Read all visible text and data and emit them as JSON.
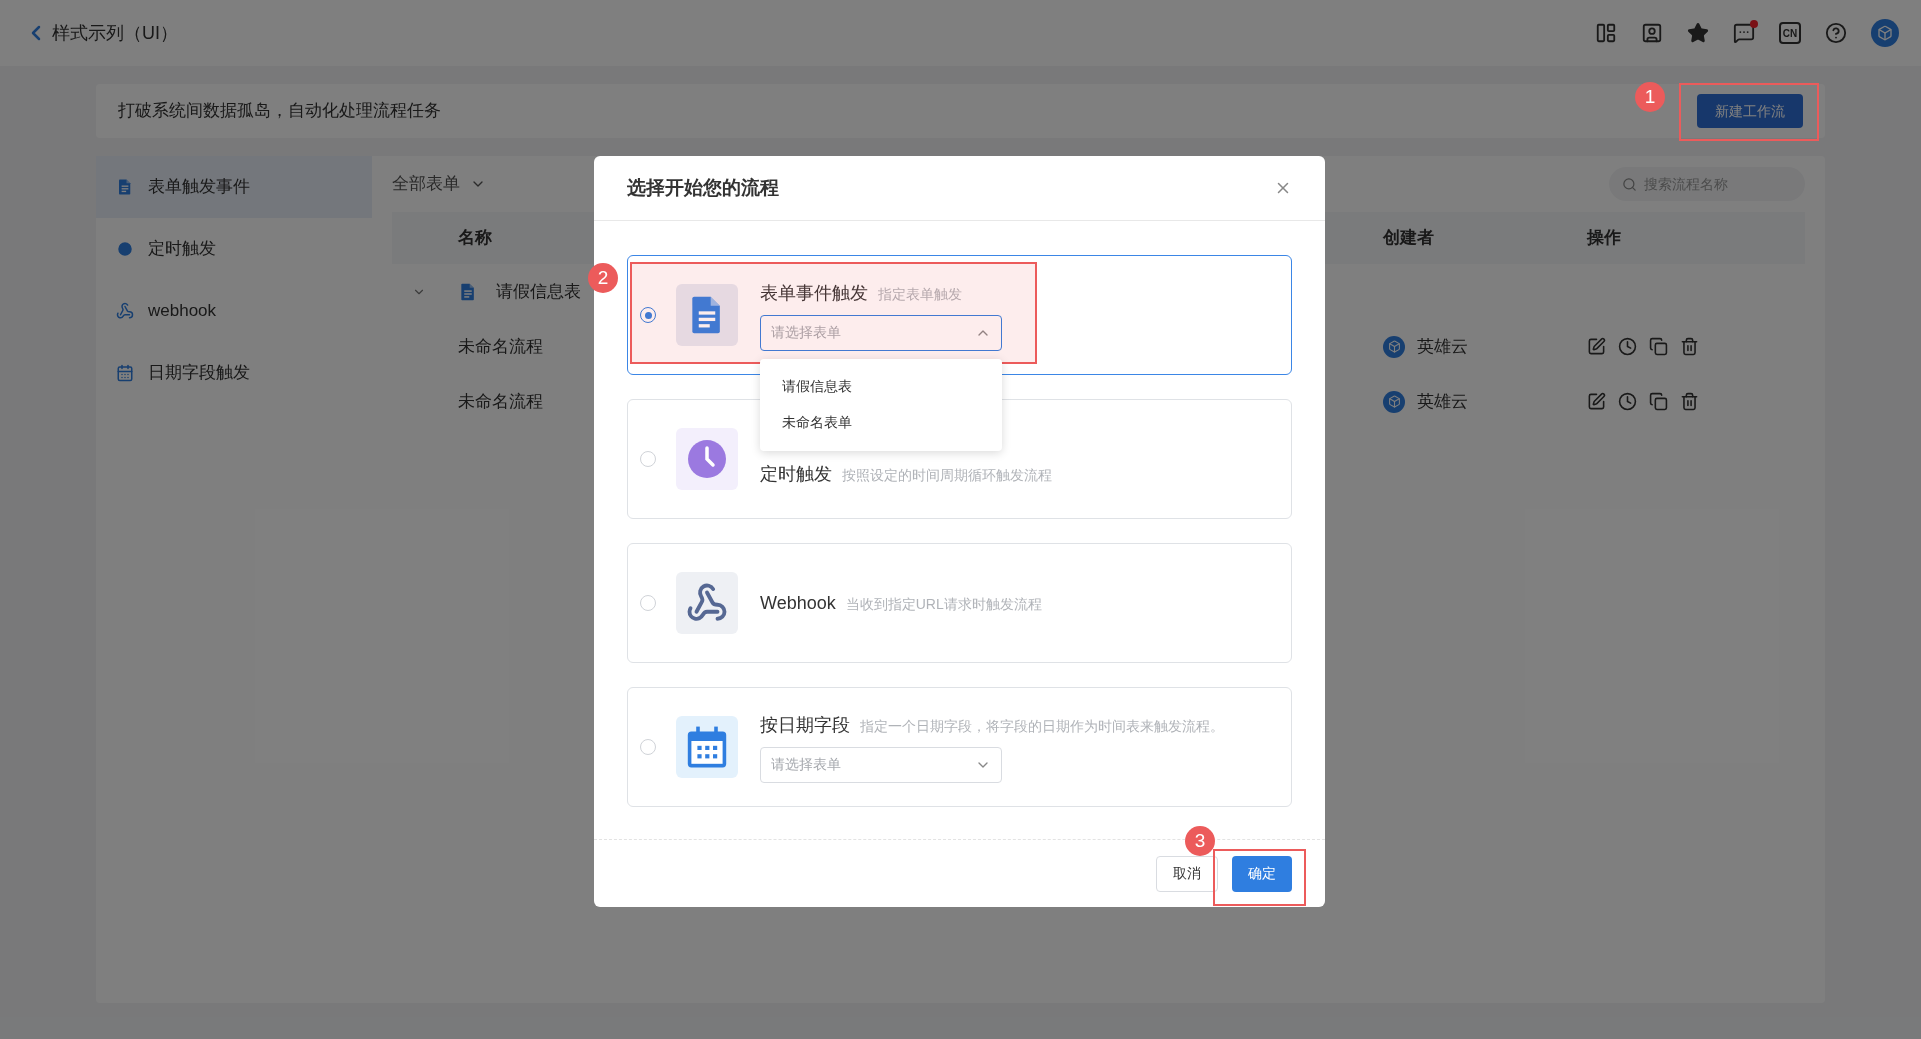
{
  "header": {
    "title": "样式示列（UI）",
    "language": "CN",
    "notification": true
  },
  "banner": {
    "text": "打破系统间数据孤岛，自动化处理流程任务",
    "button": "新建工作流"
  },
  "sidebar": {
    "items": [
      {
        "kind": "form",
        "label": "表单触发事件",
        "selected": true
      },
      {
        "kind": "timer",
        "label": "定时触发",
        "selected": false
      },
      {
        "kind": "webhook",
        "label": "webhook",
        "selected": false
      },
      {
        "kind": "date",
        "label": "日期字段触发",
        "selected": false
      }
    ]
  },
  "toolbar": {
    "filter": "全部表单",
    "search": {
      "placeholder": "搜索流程名称"
    }
  },
  "table": {
    "columns": [
      "名称",
      "创建者",
      "操作"
    ],
    "rows": [
      {
        "name": "请假信息表",
        "expanded": true,
        "children": [
          {
            "name": "未命名流程",
            "creator": "英雄云"
          },
          {
            "name": "未命名流程",
            "creator": "英雄云"
          }
        ]
      }
    ]
  },
  "modal": {
    "title": "选择开始您的流程",
    "options": [
      {
        "kind": "form",
        "title": "表单事件触发",
        "description": "指定表单触发",
        "selected": true,
        "select": {
          "placeholder": "请选择表单",
          "open": true,
          "options": [
            "请假信息表",
            "未命名表单"
          ]
        }
      },
      {
        "kind": "timer",
        "title": "定时触发",
        "description": "按照设定的时间周期循环触发流程",
        "selected": false
      },
      {
        "kind": "webhook",
        "title": "Webhook",
        "description": "当收到指定URL请求时触发流程",
        "selected": false
      },
      {
        "kind": "date",
        "title": "按日期字段",
        "description": "指定一个日期字段，将字段的日期作为时间表来触发流程。",
        "selected": false,
        "select": {
          "placeholder": "请选择表单",
          "open": false
        }
      }
    ],
    "cancel": "取消",
    "confirm": "确定"
  },
  "annotations": [
    {
      "number": "1",
      "kind": "new_workflow"
    },
    {
      "number": "2",
      "kind": "form_option"
    },
    {
      "number": "3",
      "kind": "confirm"
    }
  ]
}
